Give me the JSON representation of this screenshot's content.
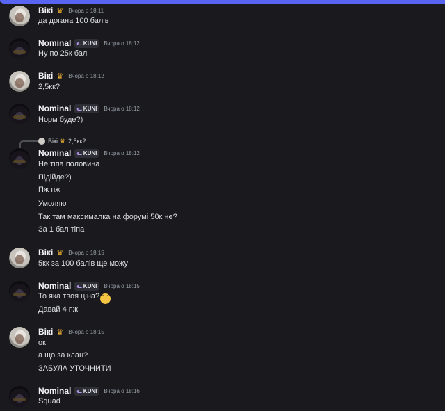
{
  "users": {
    "viki": "Вікі",
    "nominal": "Nominal",
    "clan_tag": "KUNI"
  },
  "icons": {
    "crown": "crown-icon",
    "clan_tag": "cat-icon",
    "emoji": "worried-face-emoji"
  },
  "colors": {
    "accent": "#5865f2",
    "crown": "#f0b232",
    "background": "#1a1a1e"
  },
  "messages": [
    {
      "author": "Вікі",
      "time": "Вчора о 18:11",
      "lines": [
        "да догана 100 балів"
      ]
    },
    {
      "author": "Nominal",
      "time": "Вчора о 18:12",
      "lines": [
        "Ну по 25к бал"
      ]
    },
    {
      "author": "Вікі",
      "time": "Вчора о 18:12",
      "lines": [
        "2,5кк?"
      ]
    },
    {
      "author": "Nominal",
      "time": "Вчора о 18:12",
      "lines": [
        "Норм буде?)"
      ]
    },
    {
      "author": "Nominal",
      "time": "Вчора о 18:12",
      "reply": {
        "author": "Вікі",
        "text": "2,5кк?"
      },
      "lines": [
        "Не тіпа половина",
        "Підійде?)",
        "Пж пж",
        "Умоляю",
        "Так там максималка на форумі 50к не?",
        "За 1 бал тіпа"
      ]
    },
    {
      "author": "Вікі",
      "time": "Вчора о 18:15",
      "lines": [
        "5кк за 100 балів ще можу"
      ]
    },
    {
      "author": "Nominal",
      "time": "Вчора о 18:15",
      "lines": [
        "То яка твоя ціна?",
        "Давай 4 пж"
      ]
    },
    {
      "author": "Вікі",
      "time": "Вчора о 18:15",
      "lines": [
        "ок",
        "а що за клан?",
        "ЗАБУЛА УТОЧНИТИ"
      ]
    },
    {
      "author": "Nominal",
      "time": "Вчора о 18:16",
      "lines": [
        "Squad"
      ]
    }
  ]
}
